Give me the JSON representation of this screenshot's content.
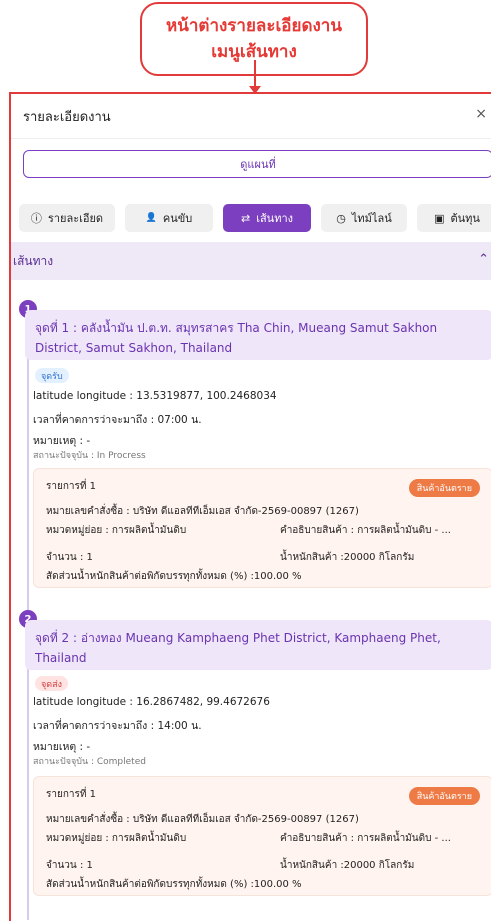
{
  "banner": {
    "line1": "หน้าต่างรายละเอียดงาน",
    "line2": "เมนูเส้นทาง"
  },
  "header": {
    "title": "รายละเอียดงาน",
    "close": "×"
  },
  "map_button": "ดูแผนที่",
  "tabs": [
    {
      "label": "รายละเอียด",
      "icon": "ⓘ"
    },
    {
      "label": "คนขับ",
      "icon": "👤"
    },
    {
      "label": "เส้นทาง",
      "icon": "⇄"
    },
    {
      "label": "ไทม์ไลน์",
      "icon": "◷"
    },
    {
      "label": "ต้นทุน",
      "icon": "▣"
    }
  ],
  "section": {
    "title": "เส้นทาง",
    "caret": "⌃"
  },
  "stops": [
    {
      "index": "1",
      "title": "จุดที่ 1 : คลังน้ำมัน ป.ต.ท. สมุทรสาคร Tha Chin, Mueang Samut Sakhon District, Samut Sakhon, Thailand",
      "tag": "จุดรับ",
      "latlng": "latitude longitude : 13.5319877, 100.2468034",
      "eta": "เวลาที่คาดการว่าจะมาถึง : 07:00 น.",
      "note": "หมายเหตุ : -",
      "status": "สถานะปัจจุบัน : In Procress",
      "item": {
        "title": "รายการที่ 1",
        "danger": "สินค้าอันตราย",
        "order": "หมายเลขคำสั่งซื้อ : บริษัท ดีแอลทีทีเอ็มเอส จำกัด-2569-00897 (1267)",
        "category": "หมวดหมู่ย่อย : การผลิตน้ำมันดิบ",
        "desc": "คำอธิบายสินค้า : การผลิตน้ำมันดิบ - ...",
        "qty": "จำนวน : 1",
        "weight": "น้ำหนักสินค้า :20000 กิโลกรัม",
        "ratio": "สัดส่วนน้ำหนักสินค้าต่อพิกัดบรรทุกทั้งหมด (%) :100.00 %"
      }
    },
    {
      "index": "2",
      "title": "จุดที่ 2 : อ่างทอง Mueang Kamphaeng Phet District, Kamphaeng Phet, Thailand",
      "tag": "จุดส่ง",
      "latlng": "latitude longitude : 16.2867482, 99.4672676",
      "eta": "เวลาที่คาดการว่าจะมาถึง : 14:00 น.",
      "note": "หมายเหตุ : -",
      "status": "สถานะปัจจุบัน : Completed",
      "item": {
        "title": "รายการที่ 1",
        "danger": "สินค้าอันตราย",
        "order": "หมายเลขคำสั่งซื้อ : บริษัท ดีแอลทีทีเอ็มเอส จำกัด-2569-00897 (1267)",
        "category": "หมวดหมู่ย่อย : การผลิตน้ำมันดิบ",
        "desc": "คำอธิบายสินค้า : การผลิตน้ำมันดิบ - ...",
        "qty": "จำนวน : 1",
        "weight": "น้ำหนักสินค้า :20000 กิโลกรัม",
        "ratio": "สัดส่วนน้ำหนักสินค้าต่อพิกัดบรรทุกทั้งหมด (%) :100.00 %"
      }
    }
  ],
  "colors": {
    "accent": "#7b3fbf",
    "annotation": "#e23a3a",
    "danger": "#ee7a45"
  }
}
